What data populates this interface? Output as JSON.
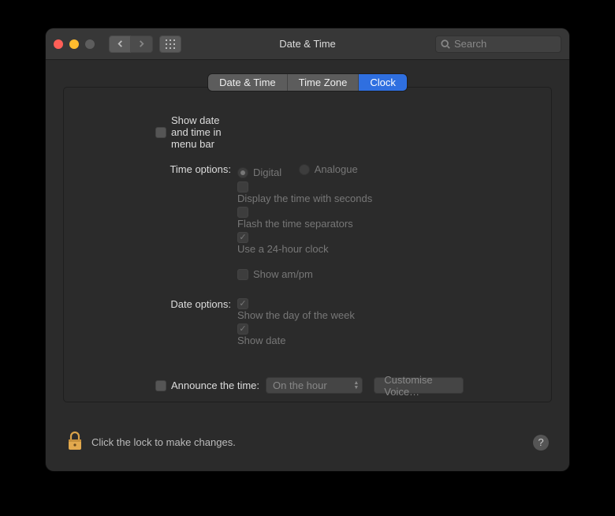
{
  "window": {
    "title": "Date & Time"
  },
  "search": {
    "placeholder": "Search"
  },
  "tabs": {
    "items": [
      "Date & Time",
      "Time Zone",
      "Clock"
    ],
    "active": 2
  },
  "main": {
    "show_menu_bar": "Show date and time in menu bar",
    "time_options_label": "Time options:",
    "digital": "Digital",
    "analogue": "Analogue",
    "display_seconds": "Display the time with seconds",
    "flash_separators": "Flash the time separators",
    "use_24h": "Use a 24-hour clock",
    "show_ampm": "Show am/pm",
    "date_options_label": "Date options:",
    "show_dow": "Show the day of the week",
    "show_date": "Show date",
    "announce_label": "Announce the time:",
    "announce_interval": "On the hour",
    "customise_voice": "Customise Voice…"
  },
  "footer": {
    "lock_text": "Click the lock to make changes."
  }
}
